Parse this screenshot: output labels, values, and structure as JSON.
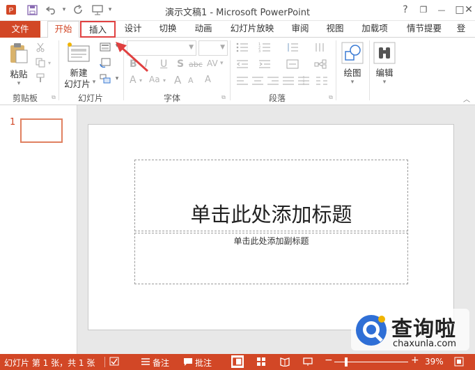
{
  "window": {
    "title": "演示文稿1 - Microsoft PowerPoint",
    "help": "?",
    "restore": "❐",
    "minimize": "—",
    "maximize": "□",
    "close": "✕"
  },
  "tabs": [
    "文件",
    "开始",
    "插入",
    "设计",
    "切换",
    "动画",
    "幻灯片放映",
    "审阅",
    "视图",
    "加载项",
    "情节提要",
    "登"
  ],
  "ribbon": {
    "paste_label": "粘贴",
    "new_slide_line1": "新建",
    "new_slide_line2": "幻灯片",
    "drawing_label": "绘图",
    "editing_label": "编辑",
    "groups": [
      "剪贴板",
      "幻灯片",
      "字体",
      "段落"
    ],
    "font_letters": {
      "bold": "B",
      "italic": "I",
      "underline": "U",
      "shadow": "S",
      "strike": "abc",
      "aa": "Aa",
      "clear": "A",
      "grow": "A",
      "shrink": "A",
      "highlight": "A",
      "color": "A"
    }
  },
  "thumbnail": {
    "number": "1"
  },
  "slide": {
    "title_placeholder": "单击此处添加标题",
    "subtitle_placeholder": "单击此处添加副标题"
  },
  "statusbar": {
    "slide_info": "幻灯片 第 1 张，共 1 张",
    "notes": "备注",
    "comments": "批注",
    "zoom": "39%"
  },
  "watermark": {
    "brand": "查询啦",
    "url": "chaxunla.com"
  },
  "colors": {
    "accent": "#d24726",
    "annotation_red": "#e04040"
  }
}
